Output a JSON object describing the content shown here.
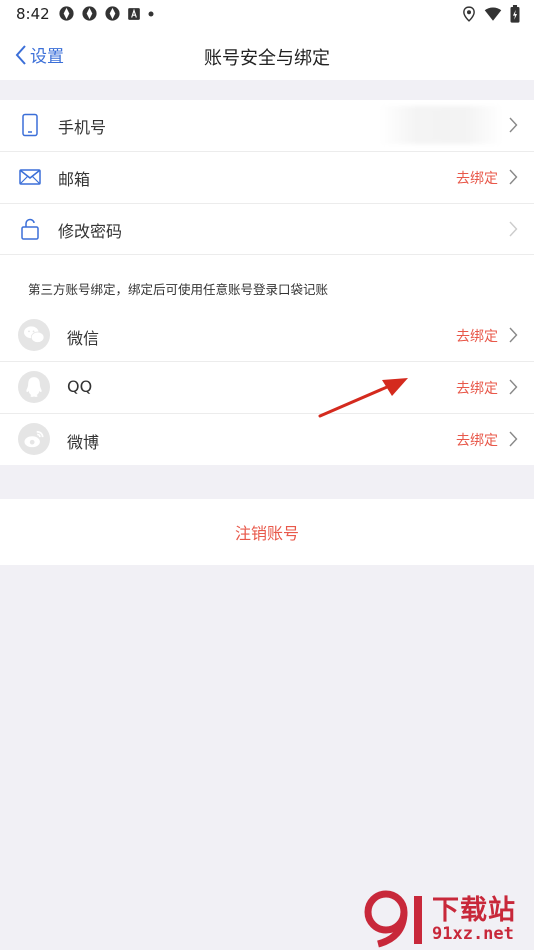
{
  "status_bar": {
    "time": "8:42",
    "left_icons": [
      "aperture-icon",
      "aperture-icon",
      "aperture-icon",
      "font-a-icon",
      "dot-icon"
    ],
    "right_icons": [
      "location-icon",
      "wifi-icon",
      "battery-icon"
    ]
  },
  "nav": {
    "back_label": "设置",
    "title": "账号安全与绑定"
  },
  "account_rows": [
    {
      "label": "手机号",
      "value": "",
      "icon": "phone-icon"
    },
    {
      "label": "邮箱",
      "value": "去绑定",
      "icon": "mail-icon"
    },
    {
      "label": "修改密码",
      "value": "",
      "icon": "lock-icon"
    }
  ],
  "third_party_hint": "第三方账号绑定，绑定后可使用任意账号登录口袋记账",
  "social_rows": [
    {
      "label": "微信",
      "value": "去绑定",
      "icon": "wechat-icon"
    },
    {
      "label": "QQ",
      "value": "去绑定",
      "icon": "qq-icon"
    },
    {
      "label": "微博",
      "value": "去绑定",
      "icon": "weibo-icon"
    }
  ],
  "cancel_account": "注销账号",
  "watermark": {
    "title": "下载站",
    "url": "91xz.net"
  },
  "colors": {
    "accent_blue": "#3b6fd8",
    "action_red": "#e8584a",
    "background": "#f1f0f5",
    "watermark_red": "#c8283a"
  }
}
